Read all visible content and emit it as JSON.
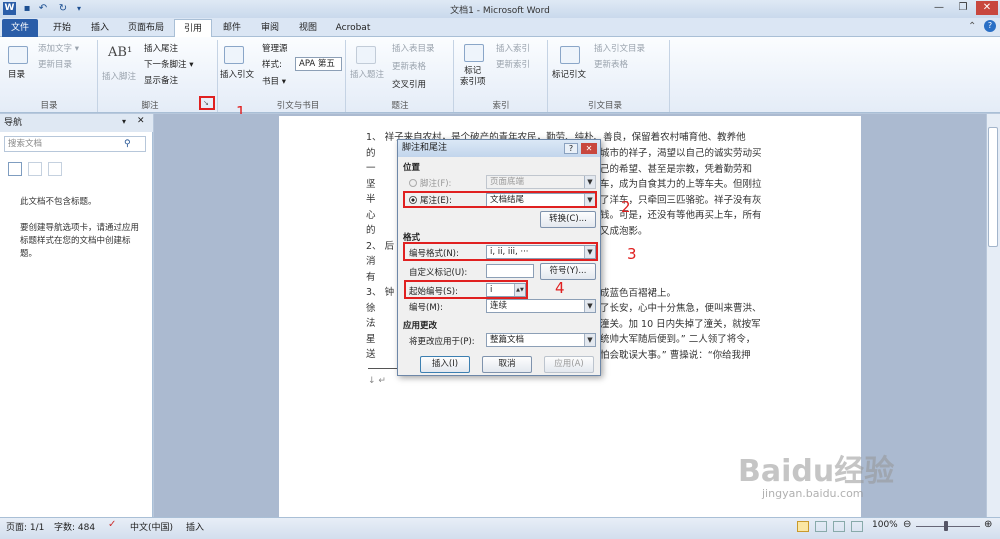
{
  "window": {
    "title": "文档1 - Microsoft Word"
  },
  "tabs": [
    "文件",
    "开始",
    "插入",
    "页面布局",
    "引用",
    "邮件",
    "审阅",
    "视图",
    "Acrobat"
  ],
  "ribbon": {
    "toc": {
      "big": "目录",
      "add_text": "添加文字 ▾",
      "update": "更新目录",
      "group": "目录"
    },
    "footnotes": {
      "big": "插入脚注",
      "insert_endnote": "插入尾注",
      "next_footnote": "下一条脚注 ▾",
      "show_notes": "显示备注",
      "group": "脚注"
    },
    "citations": {
      "big": "插入引文",
      "manage": "管理源",
      "style_label": "样式:",
      "style_value": "APA 第五",
      "bibliography": "书目 ▾",
      "group": "引文与书目"
    },
    "captions": {
      "big": "插入题注",
      "insert_table": "插入表目录",
      "update_table": "更新表格",
      "cross_ref": "交叉引用",
      "group": "题注"
    },
    "index": {
      "big": "标记\n索引项",
      "insert_index": "插入索引",
      "update_index": "更新索引",
      "group": "索引"
    },
    "authorities": {
      "big": "标记引文",
      "insert_table": "插入引文目录",
      "update_table": "更新表格",
      "group": "引文目录"
    }
  },
  "nav": {
    "title": "导航",
    "search_placeholder": "搜索文档",
    "message": "此文档不包含标题。\n\n要创建导航选项卡，请通过应用标题样式在您的文档中创建标题。"
  },
  "document": {
    "lines": [
      "1、  祥子来自农村，是个破产的青年农民，勤劳、纯朴、善良，保留着农村哺育他、教养他",
      "的",
      "一",
      "坚",
      "半",
      "心",
      "的",
      "2、  后",
      "消",
      "有",
      "3、  钟",
      "徐",
      "法",
      "星",
      "送"
    ],
    "right_fragments": [
      "城市的祥子，渴望以自己的诚实劳动买",
      "己的希望、甚至是宗教，凭着勤劳和",
      "车，成为自食其力的上等车夫。但刚拉",
      "了洋车，只牵回三匹骆驼。祥子没有灰",
      "钱。可是，还没有等他再买上车，所有",
      "又成泡影。",
      "",
      "",
      "",
      "成蓝色百褶裙上。",
      "了长安，心中十分焦急，便叫来曹洪、",
      "潼关。加 10 日内失掉了潼关，就按军",
      "统帅大军随后便到。” 二人领了将令，",
      "怕会耽误大事。” 曹操说：“你给我押"
    ]
  },
  "dialog": {
    "title": "脚注和尾注",
    "position_label": "位置",
    "footnote_label": "脚注(F):",
    "footnote_value": "页面底端",
    "endnote_label": "尾注(E):",
    "endnote_value": "文档结尾",
    "convert_btn": "转换(C)...",
    "format_label": "格式",
    "number_format_label": "编号格式(N):",
    "number_format_value": "i, ii, iii, ···",
    "custom_mark_label": "自定义标记(U):",
    "symbol_btn": "符号(Y)...",
    "start_at_label": "起始编号(S):",
    "start_at_value": "i",
    "numbering_label": "编号(M):",
    "numbering_value": "连续",
    "apply_section_label": "应用更改",
    "apply_to_label": "将更改应用于(P):",
    "apply_to_value": "整篇文档",
    "insert_btn": "插入(I)",
    "cancel_btn": "取消",
    "apply_btn": "应用(A)"
  },
  "annotations": [
    "1",
    "2",
    "3",
    "4"
  ],
  "status": {
    "page": "页面: 1/1",
    "words": "字数: 484",
    "lang": "中文(中国)",
    "mode": "插入",
    "zoom": "100%"
  },
  "watermark": {
    "brand": "Baidu经验",
    "url": "jingyan.baidu.com"
  }
}
